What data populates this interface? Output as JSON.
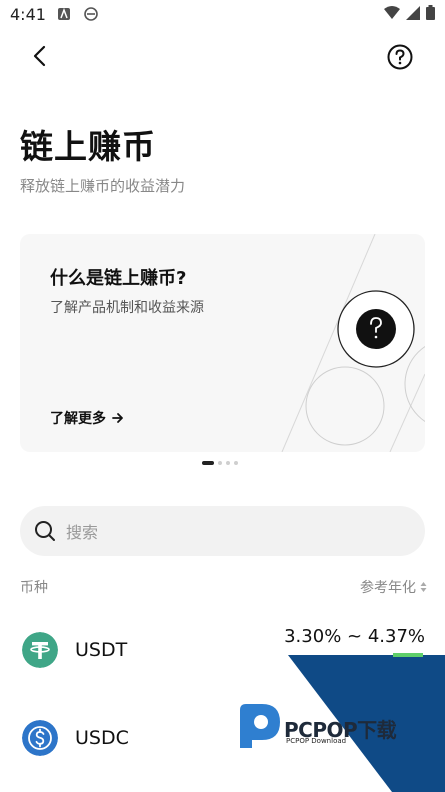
{
  "status_bar": {
    "time": "4:41"
  },
  "nav": {
    "back_icon": "chevron-left-icon",
    "help_icon": "question-circle-icon"
  },
  "header": {
    "title": "链上赚币",
    "subtitle": "释放链上赚币的收益潜力"
  },
  "promo": {
    "title": "什么是链上赚币?",
    "description": "了解产品机制和收益来源",
    "link_label": "了解更多",
    "slide_count": 4,
    "active_slide": 1
  },
  "search": {
    "placeholder": "搜索"
  },
  "list": {
    "col_coin": "币种",
    "col_apy": "参考年化",
    "items": [
      {
        "name": "USDT",
        "apy": "3.30% ~ 4.37%",
        "icon": "tether-icon",
        "color": "#3fa687"
      },
      {
        "name": "USDC",
        "apy": "",
        "icon": "usdc-icon",
        "color": "#2d75c9"
      }
    ]
  },
  "watermark": {
    "text": "PCPOP下载",
    "sub": "PCPOP Download"
  }
}
